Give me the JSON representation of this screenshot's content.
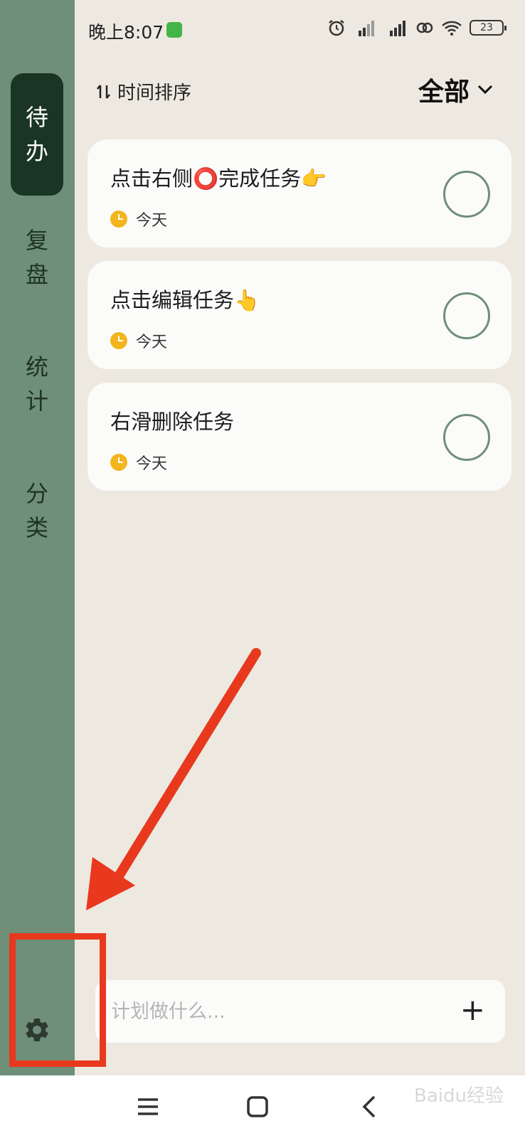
{
  "status_bar": {
    "time": "晚上8:07",
    "battery": "23"
  },
  "sidebar": {
    "items": [
      {
        "chars": [
          "待",
          "办"
        ]
      },
      {
        "chars": [
          "复",
          "盘"
        ]
      },
      {
        "chars": [
          "统",
          "计"
        ]
      },
      {
        "chars": [
          "分",
          "类"
        ]
      }
    ],
    "settings_icon": "gear-icon"
  },
  "header": {
    "sort_label": "时间排序",
    "filter_label": "全部"
  },
  "tasks": [
    {
      "title": "点击右侧⭕完成任务👉",
      "date": "今天"
    },
    {
      "title": "点击编辑任务👆",
      "date": "今天"
    },
    {
      "title": "右滑删除任务",
      "date": "今天"
    }
  ],
  "input": {
    "placeholder": "计划做什么...",
    "add_symbol": "+"
  },
  "watermark": "Baidu经验",
  "colors": {
    "sidebar": "#6f8f78",
    "sidebar_active": "#1a3524",
    "background": "#ede9e0",
    "annotation": "#e8391f",
    "clock": "#f3b51d"
  }
}
